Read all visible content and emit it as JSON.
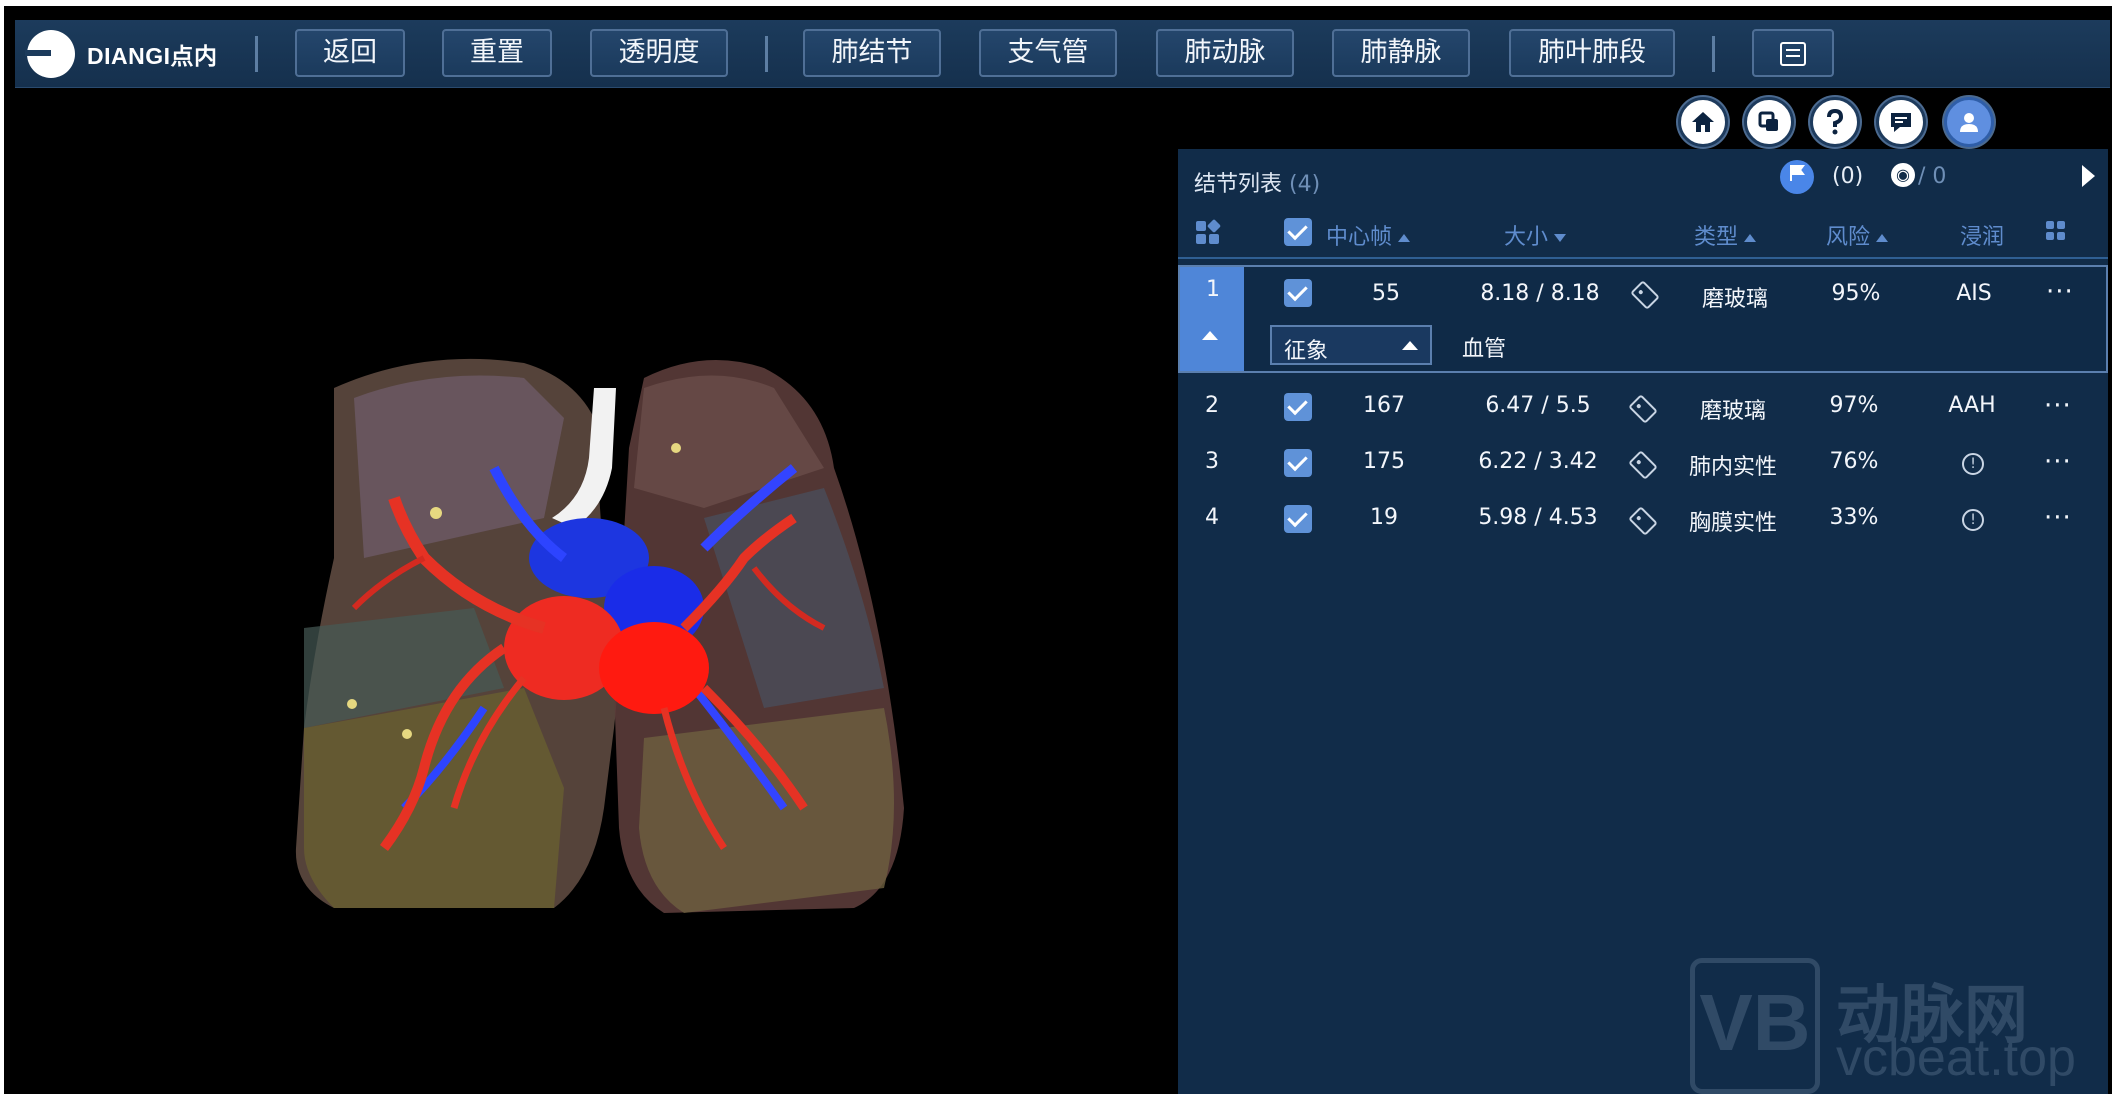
{
  "app": {
    "logo_text": "DIANGI点内"
  },
  "toolbar": {
    "buttons": [
      {
        "label": "返回"
      },
      {
        "label": "重置"
      },
      {
        "label": "透明度"
      },
      {
        "label": "肺结节"
      },
      {
        "label": "支气管"
      },
      {
        "label": "肺动脉"
      },
      {
        "label": "肺静脉"
      },
      {
        "label": "肺叶肺段"
      }
    ]
  },
  "icons": [
    "home-icon",
    "copy-icon",
    "help-icon",
    "chat-icon",
    "user-icon",
    "clipboard-icon",
    "flag-icon",
    "eye-icon",
    "tag-icon",
    "info-icon",
    "more-icon",
    "grid-icon"
  ],
  "colors": {
    "accent": "#4f86d8",
    "panel": "#112c49",
    "toolbar": "#1c3b5c",
    "header_text": "#5f8ccd"
  },
  "nodule_panel": {
    "title": "结节列表",
    "count": "(4)",
    "flag_count": "(0)",
    "eye_count": "/ 0",
    "columns": [
      "中心帧",
      "大小",
      "类型",
      "风险",
      "浸润"
    ],
    "rows": [
      {
        "index": "1",
        "frame": "55",
        "size": "8.18 / 8.18",
        "type": "磨玻璃",
        "risk": "95%",
        "invasion": "AIS",
        "sign_label": "征象",
        "sign_value": "血管"
      },
      {
        "index": "2",
        "frame": "167",
        "size": "6.47 / 5.5",
        "type": "磨玻璃",
        "risk": "97%",
        "invasion": "AAH"
      },
      {
        "index": "3",
        "frame": "175",
        "size": "6.22 / 3.42",
        "type": "肺内实性",
        "risk": "76%",
        "invasion": ""
      },
      {
        "index": "4",
        "frame": "19",
        "size": "5.98 / 4.53",
        "type": "胸膜实性",
        "risk": "33%",
        "invasion": ""
      }
    ],
    "more_glyph": "···"
  },
  "watermark": {
    "box": "VB",
    "cn": "动脉网",
    "en": "vcbeat.top"
  }
}
